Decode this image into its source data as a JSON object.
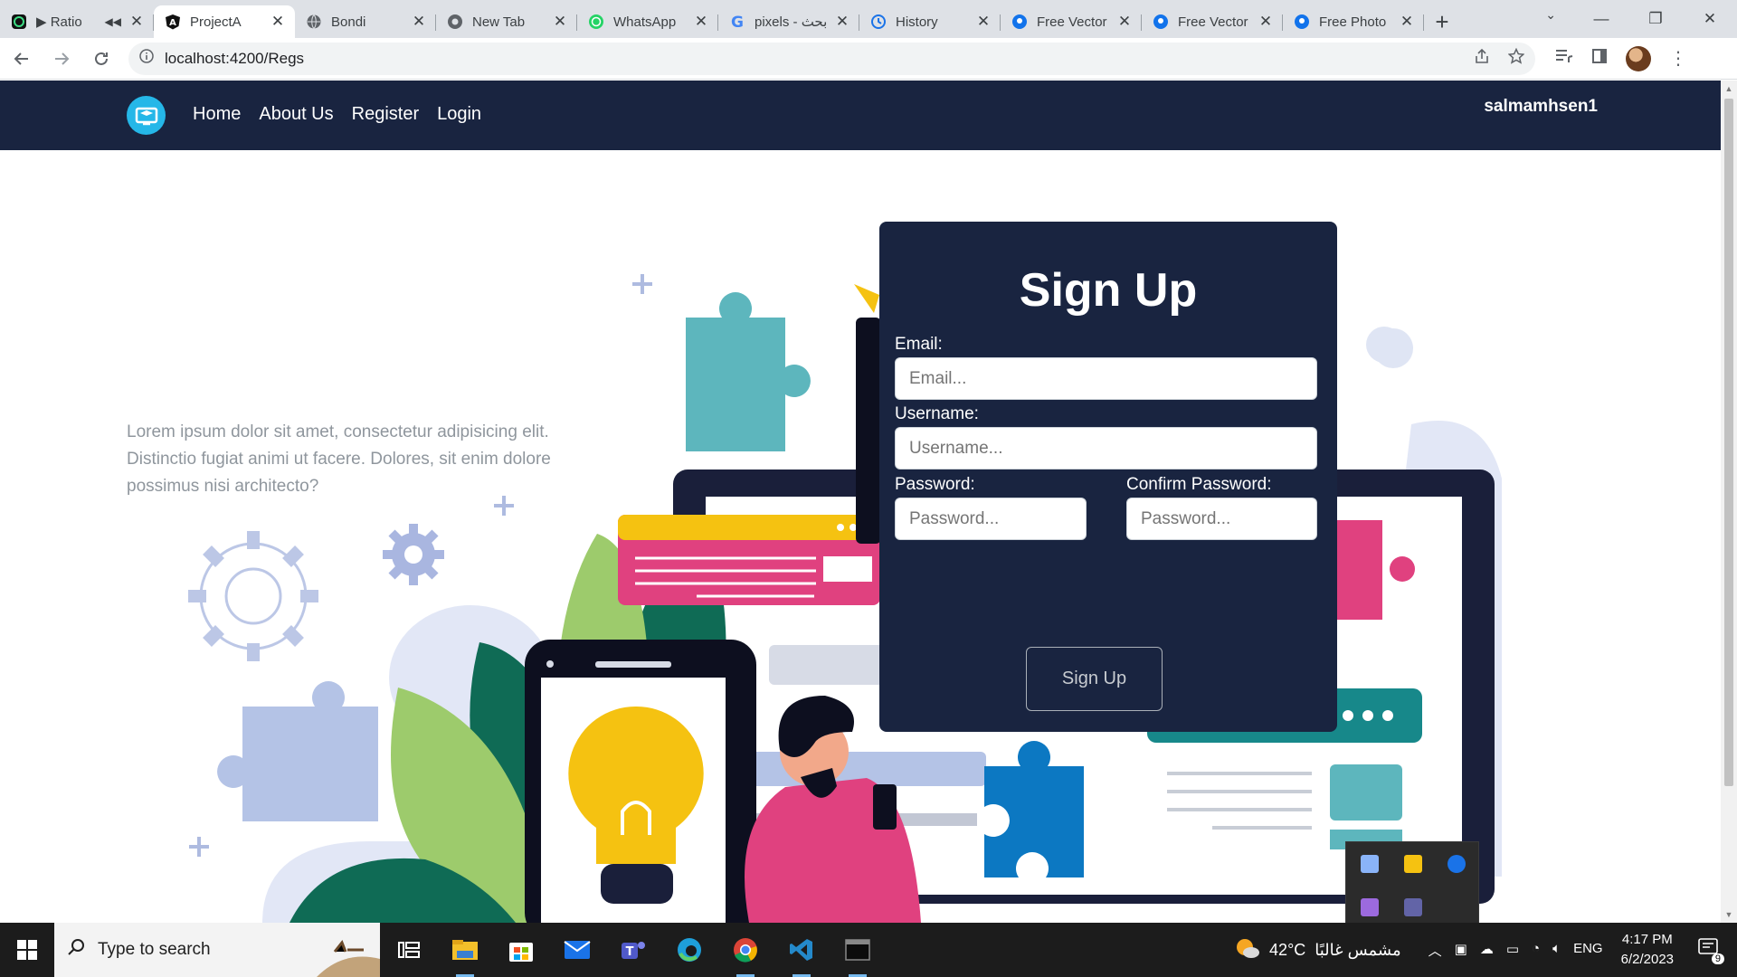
{
  "browser": {
    "tabs": [
      {
        "title": "Ratio",
        "icon": "green-app-icon",
        "active": false
      },
      {
        "title": "ProjectA",
        "icon": "angular-icon",
        "active": true
      },
      {
        "title": "Bondi",
        "icon": "globe-icon",
        "active": false
      },
      {
        "title": "New Tab",
        "icon": "chrome-icon",
        "active": false
      },
      {
        "title": "WhatsApp",
        "icon": "whatsapp-icon",
        "active": false
      },
      {
        "title": "pixels - بحث",
        "icon": "google-icon",
        "active": false
      },
      {
        "title": "History",
        "icon": "history-icon",
        "active": false
      },
      {
        "title": "Free Vector",
        "icon": "freepik-icon",
        "active": false
      },
      {
        "title": "Free Vector",
        "icon": "freepik-icon",
        "active": false
      },
      {
        "title": "Free Photo",
        "icon": "freepik-icon",
        "active": false
      }
    ],
    "url": "localhost:4200/Regs"
  },
  "app": {
    "nav": {
      "home": "Home",
      "about": "About Us",
      "register": "Register",
      "login": "Login"
    },
    "username": "salmamhsen1",
    "lorem": "Lorem ipsum dolor sit amet, consectetur adipisicing elit. Distinctio fugiat animi ut facere. Dolores, sit enim dolore possimus nisi architecto?",
    "form": {
      "title": "Sign Up",
      "email_label": "Email:",
      "email_placeholder": "Email...",
      "username_label": "Username:",
      "username_placeholder": "Username...",
      "password_label": "Password:",
      "password_placeholder": "Password...",
      "confirm_label": "Confirm Password:",
      "confirm_placeholder": "Password...",
      "submit": "Sign Up"
    },
    "colors": {
      "navbar": "#192440",
      "accent": "#25b7e8"
    }
  },
  "taskbar": {
    "search_placeholder": "Type to search",
    "weather_temp": "42°C",
    "weather_text": "مشمس غالبًا",
    "language": "ENG",
    "time": "4:17 PM",
    "date": "6/2/2023",
    "notifications": "9"
  }
}
